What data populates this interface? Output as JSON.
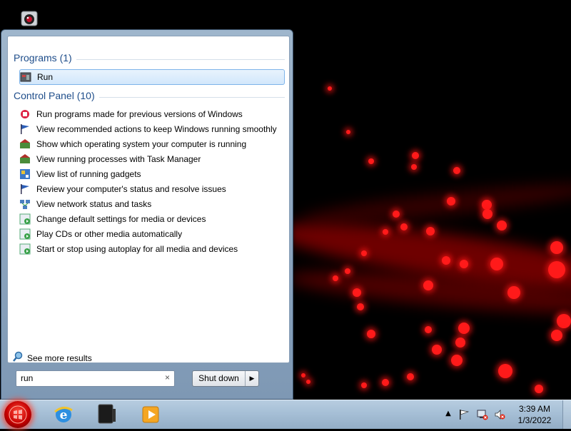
{
  "colors": {
    "group_header": "#1e4d8a",
    "accent_red": "#ff1a1a",
    "taskbar": "#a6bfd6"
  },
  "desktop": {
    "icons": [
      {
        "icon": "webcam-icon"
      }
    ]
  },
  "start_menu": {
    "groups": [
      {
        "title": "Programs (1)",
        "items": [
          {
            "label": "Run",
            "icon": "run-icon",
            "selected": true
          }
        ]
      },
      {
        "title": "Control Panel (10)",
        "items": [
          {
            "label": "Run programs made for previous versions of Windows",
            "icon": "compatibility-icon"
          },
          {
            "label": "View recommended actions to keep Windows running smoothly",
            "icon": "action-center-flag-icon"
          },
          {
            "label": "Show which operating system your computer is running",
            "icon": "system-icon"
          },
          {
            "label": "View running processes with Task Manager",
            "icon": "system-icon"
          },
          {
            "label": "View list of running gadgets",
            "icon": "gadgets-icon"
          },
          {
            "label": "Review your computer's status and resolve issues",
            "icon": "action-center-flag-icon"
          },
          {
            "label": "View network status and tasks",
            "icon": "network-icon"
          },
          {
            "label": "Change default settings for media or devices",
            "icon": "autoplay-icon"
          },
          {
            "label": "Play CDs or other media automatically",
            "icon": "autoplay-icon"
          },
          {
            "label": "Start or stop using autoplay for all media and devices",
            "icon": "autoplay-icon"
          }
        ]
      }
    ],
    "see_more": "See more results",
    "search": {
      "value": "run",
      "clear": "×"
    },
    "shutdown": {
      "label": "Shut down",
      "arrow": "▶"
    }
  },
  "taskbar": {
    "pinned": [
      "internet-explorer-icon",
      "media-center-icon",
      "media-player-icon"
    ],
    "tray": {
      "show_hidden": "▲",
      "icons": [
        "action-center-flag-icon",
        "network-disconnected-icon",
        "volume-muted-icon"
      ]
    },
    "clock": {
      "time": "3:39 AM",
      "date": "1/3/2022"
    }
  }
}
